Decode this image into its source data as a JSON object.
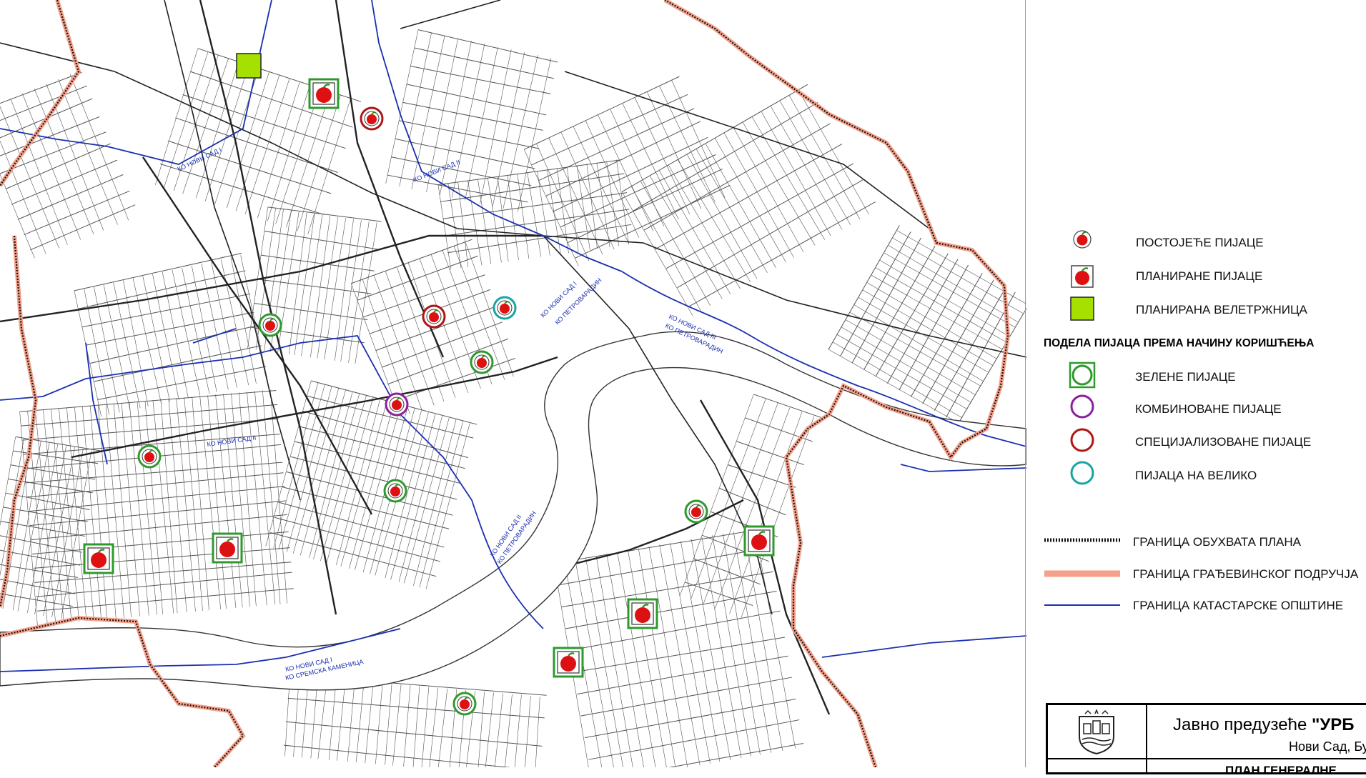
{
  "legend": {
    "existing_markets": "ПОСТОЈЕЋЕ ПИЈАЦЕ",
    "planned_markets": "ПЛАНИРАНЕ ПИЈАЦЕ",
    "planned_wholesale": "ПЛАНИРАНА ВЕЛЕТРЖНИЦА",
    "division_heading": "ПОДЕЛА ПИЈАЦА ПРЕМА НАЧИНУ КОРИШЋЕЊА",
    "green_markets": "ЗЕЛЕНЕ ПИЈАЦЕ",
    "combined_markets": "КОМБИНОВАНЕ ПИЈАЦЕ",
    "specialized_markets": "СПЕЦИЈАЛИЗОВАНЕ ПИЈАЦЕ",
    "wholesale_market": "ПИЈАЦА НА ВЕЛИКО",
    "plan_boundary": "ГРАНИЦА ОБУХВАТА ПЛАНА",
    "construction_boundary": "ГРАНИЦА ГРАЂЕВИНСКОГ ПОДРУЧЈА",
    "cadastral_boundary": "ГРАНИЦА КАТАСТАРСКЕ ОПШТИНЕ"
  },
  "title_block": {
    "company_prefix": "Јавно предузеће ",
    "company_name": "\"УРБ",
    "address": "Нови Сад, Бул",
    "plan_title": "ПЛАН ГЕНЕРАЛНЕ"
  },
  "map_labels": {
    "ko_ns1": "КО НОВИ САД I",
    "ko_ns2": "КО НОВИ САД II",
    "ko_ns3": "КО НОВИ САД III",
    "ko_petrovaradin": "КО ПЕТРОВАРАДИН",
    "ko_sremska": "КО СРЕМСКА КАМЕНИЦА"
  },
  "colors": {
    "green_ring": "#2e9a2e",
    "combined_ring": "#8a1fa0",
    "specialized_ring": "#b01515",
    "wholesale_ring": "#1aa3a3",
    "wholesale_square": "#a6e000",
    "construction_boundary": "#f4a08a",
    "cadastral_boundary": "#1b2fb0",
    "apple": "#dd1111"
  },
  "markers": [
    {
      "kind": "wholesale-square"
    },
    {
      "kind": "planned",
      "ring": "green"
    },
    {
      "kind": "existing",
      "ring": "specialized"
    },
    {
      "kind": "existing",
      "ring": "green"
    },
    {
      "kind": "existing",
      "ring": "specialized"
    },
    {
      "kind": "existing",
      "ring": "wholesale"
    },
    {
      "kind": "existing",
      "ring": "green"
    },
    {
      "kind": "existing",
      "ring": "combined"
    },
    {
      "kind": "existing",
      "ring": "green"
    },
    {
      "kind": "existing",
      "ring": "green"
    },
    {
      "kind": "planned",
      "ring": "green"
    },
    {
      "kind": "planned",
      "ring": "green"
    },
    {
      "kind": "existing",
      "ring": "green"
    },
    {
      "kind": "planned",
      "ring": "green"
    },
    {
      "kind": "planned",
      "ring": "green"
    },
    {
      "kind": "planned",
      "ring": "green"
    },
    {
      "kind": "existing",
      "ring": "green"
    }
  ]
}
